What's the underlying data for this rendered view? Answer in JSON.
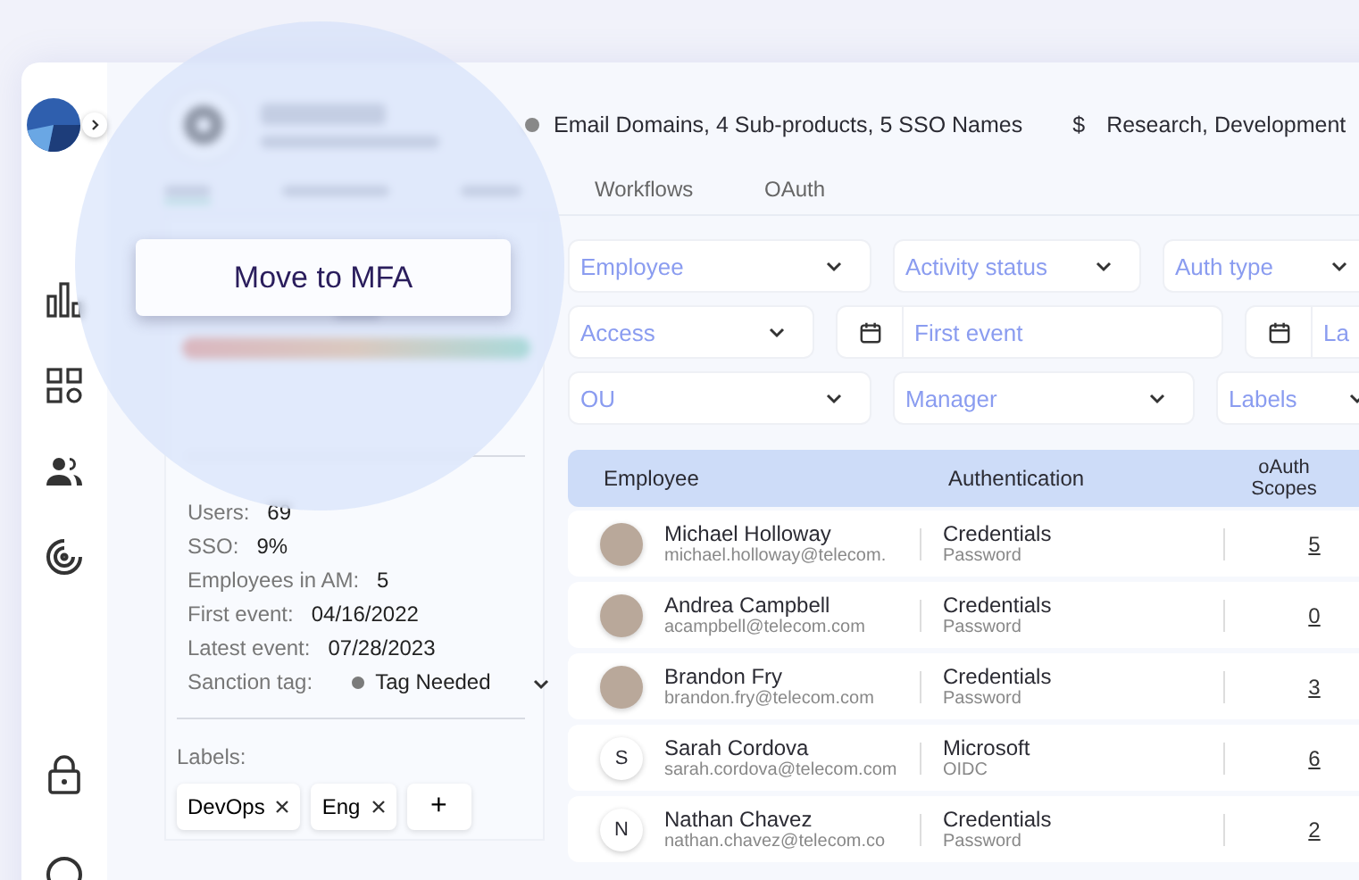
{
  "app": {
    "domains": "Email Domains, 4 Sub-products, 5 SSO Names",
    "currency_icon": "$",
    "cost_centers": "Research, Development"
  },
  "tabs": [
    {
      "label": "Workflows",
      "selected": false
    },
    {
      "label": "OAuth",
      "selected": false
    }
  ],
  "overlay": {
    "button": "Move to MFA"
  },
  "summary": {
    "stats": [
      {
        "label": "Users:",
        "value": "69"
      },
      {
        "label": "SSO:",
        "value": "9%"
      },
      {
        "label": "Employees in AM:",
        "value": "5"
      },
      {
        "label": "First event:",
        "value": "04/16/2022"
      },
      {
        "label": "Latest event:",
        "value": "07/28/2023"
      }
    ],
    "sanction": {
      "label": "Sanction tag:",
      "value": "Tag Needed",
      "color": "#7b7b7b"
    },
    "labels_title": "Labels:",
    "labels": [
      "DevOps",
      "Eng"
    ],
    "add_icon": "+"
  },
  "filters": [
    [
      {
        "kind": "select",
        "placeholder": "Employee"
      },
      {
        "kind": "select",
        "placeholder": "Activity status"
      },
      {
        "kind": "select",
        "placeholder": "Auth type"
      }
    ],
    [
      {
        "kind": "select",
        "placeholder": "Access"
      },
      {
        "kind": "date",
        "placeholder": "First event"
      },
      {
        "kind": "date",
        "placeholder": "La"
      }
    ],
    [
      {
        "kind": "select",
        "placeholder": "OU"
      },
      {
        "kind": "select",
        "placeholder": "Manager"
      },
      {
        "kind": "select",
        "placeholder": "Labels"
      }
    ]
  ],
  "table": {
    "columns": [
      "Employee",
      "Authentication",
      "oAuth Scopes"
    ],
    "rows": [
      {
        "avatar": {
          "kind": "photo"
        },
        "name": "Michael Holloway",
        "email": "michael.holloway@telecom.",
        "auth": "Credentials",
        "auth_type": "Password",
        "scopes": "5"
      },
      {
        "avatar": {
          "kind": "photo"
        },
        "name": "Andrea Campbell",
        "email": "acampbell@telecom.com",
        "auth": "Credentials",
        "auth_type": "Password",
        "scopes": "0"
      },
      {
        "avatar": {
          "kind": "photo"
        },
        "name": "Brandon Fry",
        "email": "brandon.fry@telecom.com",
        "auth": "Credentials",
        "auth_type": "Password",
        "scopes": "3"
      },
      {
        "avatar": {
          "kind": "initial",
          "letter": "S"
        },
        "name": "Sarah Cordova",
        "email": "sarah.cordova@telecom.com",
        "auth": "Microsoft",
        "auth_type": "OIDC",
        "scopes": "6"
      },
      {
        "avatar": {
          "kind": "initial",
          "letter": "N"
        },
        "name": "Nathan Chavez",
        "email": "nathan.chavez@telecom.co",
        "auth": "Credentials",
        "auth_type": "Password",
        "scopes": "2"
      }
    ]
  }
}
